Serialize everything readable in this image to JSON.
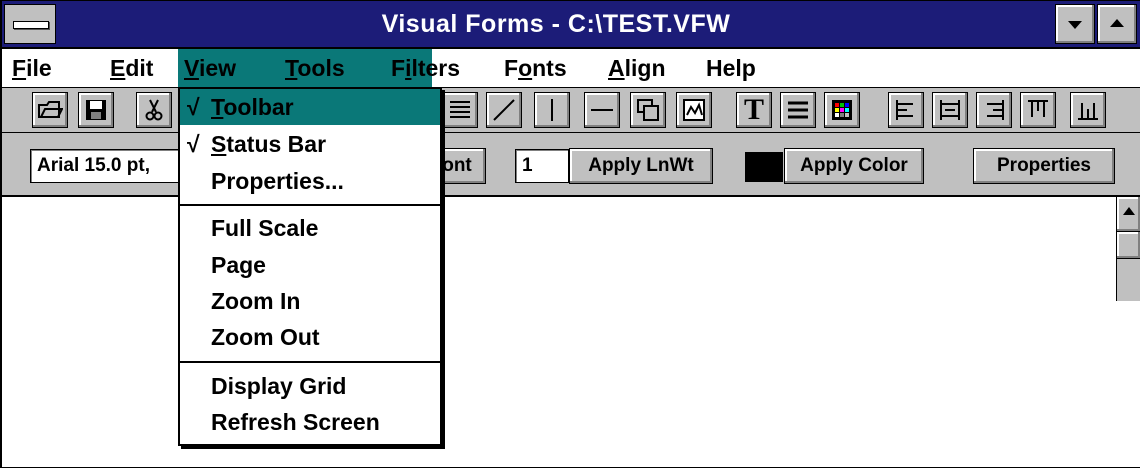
{
  "window": {
    "title": "Visual Forms - C:\\TEST.VFW"
  },
  "menubar": {
    "items": [
      {
        "label": "File",
        "ul": "F",
        "rest": "ile"
      },
      {
        "label": "Edit",
        "ul": "E",
        "rest": "dit"
      },
      {
        "label": "View",
        "ul": "V",
        "rest": "iew"
      },
      {
        "label": "Tools",
        "ul": "T",
        "rest": "ools"
      },
      {
        "label": "Filters",
        "pre": "F",
        "ul": "i",
        "rest": "lters"
      },
      {
        "label": "Fonts",
        "pre": "F",
        "ul": "o",
        "rest": "nts"
      },
      {
        "label": "Align",
        "ul": "A",
        "rest": "lign"
      },
      {
        "label": "Help",
        "ul": "",
        "rest": "Help"
      }
    ],
    "active": "View"
  },
  "view_menu": {
    "items": [
      {
        "label": "Toolbar",
        "checked": true,
        "check": "√",
        "ul": "T",
        "rest": "oolbar"
      },
      {
        "label": "Status Bar",
        "checked": true,
        "check": "√",
        "ul": "S",
        "rest": "tatus Bar"
      },
      {
        "label": "Properties...",
        "checked": false
      },
      {
        "label": "Full Scale",
        "checked": false
      },
      {
        "label": "Page",
        "checked": false
      },
      {
        "label": "Zoom In",
        "checked": false
      },
      {
        "label": "Zoom Out",
        "checked": false
      },
      {
        "label": "Display Grid",
        "checked": false
      },
      {
        "label": "Refresh Screen",
        "checked": false
      }
    ],
    "highlighted": "Toolbar"
  },
  "formatbar": {
    "font_field": "Arial 15.0 pt,",
    "font_button_visible": "ont",
    "line_width": "1",
    "apply_lnwt": "Apply LnWt",
    "apply_color": "Apply Color",
    "properties": "Properties",
    "current_color": "#000000"
  },
  "toolbar": {
    "icons": [
      "open-icon",
      "save-icon",
      "cut-icon",
      "align-text-icon",
      "diagonal-line-icon",
      "vertical-line-icon",
      "horizontal-line-icon",
      "rectangle-icon",
      "image-icon",
      "text-icon",
      "lines-icon",
      "color-grid-icon",
      "align-left-icon",
      "align-center-icon",
      "align-right-icon",
      "align-top-icon",
      "align-bottom-icon"
    ],
    "text_tool_glyph": "T"
  },
  "colors": {
    "titlebar": "#1c1c78",
    "highlight": "#0a7878",
    "chrome": "#c0c0c0"
  }
}
